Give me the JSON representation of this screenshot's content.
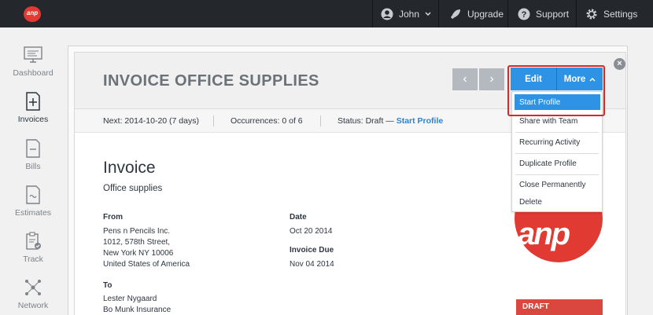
{
  "topbar": {
    "logo_text": "anp",
    "user": "John",
    "upgrade": "Upgrade",
    "support": "Support",
    "settings": "Settings"
  },
  "sidebar": {
    "items": [
      {
        "label": "Dashboard",
        "icon": "monitor-icon"
      },
      {
        "label": "Invoices",
        "icon": "invoice-add-icon",
        "active": true
      },
      {
        "label": "Bills",
        "icon": "bill-icon"
      },
      {
        "label": "Estimates",
        "icon": "estimate-icon"
      },
      {
        "label": "Track",
        "icon": "clipboard-check-icon"
      },
      {
        "label": "Network",
        "icon": "network-icon"
      }
    ]
  },
  "panel": {
    "title": "INVOICE OFFICE SUPPLIES",
    "prev": "‹",
    "next": "›",
    "close": "×"
  },
  "infobar": {
    "next": "Next: 2014-10-20 (7 days)",
    "occurrences": "Occurrences: 0 of 6",
    "status": "Status: Draft —",
    "status_link": "Start Profile"
  },
  "actions": {
    "edit": "Edit",
    "more": "More",
    "menu": [
      "Start Profile",
      "Share with Team",
      "Recurring Activity",
      "Duplicate Profile",
      "Close Permanently",
      "Delete"
    ]
  },
  "invoice": {
    "title": "Invoice",
    "subtitle": "Office supplies",
    "from_label": "From",
    "from_lines": [
      "Pens n Pencils Inc.",
      "1012, 578th Street,",
      "New York NY 10006",
      "United States of America"
    ],
    "date_label": "Date",
    "date": "Oct 20 2014",
    "due_label": "Invoice Due",
    "due": "Nov 04 2014",
    "to_label": "To",
    "to_lines": [
      "Lester Nygaard",
      "Bo Munk Insurance"
    ],
    "brand_text": "anp",
    "draft": "DRAFT"
  },
  "colors": {
    "accent": "#2e93e5",
    "topbar": "#24282d",
    "brand_red": "#e13a32",
    "highlight_outline": "#d42a2a"
  }
}
